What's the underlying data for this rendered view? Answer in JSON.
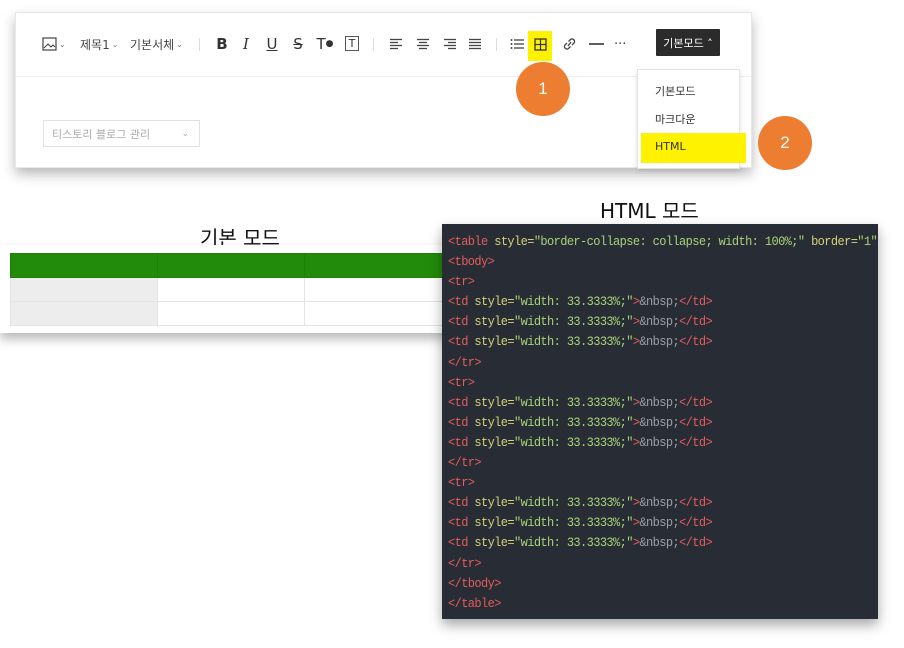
{
  "toolbar": {
    "image_caret": "⌄",
    "heading": "제목1",
    "font": "기본서체",
    "bold": "B",
    "italic": "I",
    "underline": "U",
    "strike": "S",
    "text_color": "T",
    "text_bg": "T",
    "more": "···",
    "mode_button": "기본모드 ˄"
  },
  "dropdown": {
    "items": [
      "기본모드",
      "마크다운",
      "HTML"
    ]
  },
  "blog_select": {
    "value": "티스토리 블로그 관리",
    "chevron": "⌄"
  },
  "badges": [
    "1",
    "2"
  ],
  "labels": {
    "basic_mode": "기본 모드",
    "html_mode": "HTML 모드"
  },
  "colors": {
    "highlight": "#fff200",
    "badge": "#ed7d31",
    "table_header": "#228b0c",
    "code_bg": "#282c34"
  },
  "basic_table": {
    "columns": 3,
    "rows": [
      "header",
      "gray-first",
      "gray-first"
    ]
  },
  "code": {
    "lines": [
      [
        [
          "tag",
          "<table "
        ],
        [
          "attr",
          "style="
        ],
        [
          "str",
          "\"border-collapse: collapse; width: 100%;\""
        ],
        [
          "attr",
          " border="
        ],
        [
          "str",
          "\"1\""
        ],
        [
          "tag",
          ">"
        ]
      ],
      [
        [
          "tag",
          "<tbody>"
        ]
      ],
      [
        [
          "tag",
          "<tr>"
        ]
      ],
      [
        [
          "tag",
          "<td "
        ],
        [
          "attr",
          "style="
        ],
        [
          "str",
          "\"width: 33.3333%;\""
        ],
        [
          "tag",
          ">"
        ],
        [
          "ent",
          "&nbsp;"
        ],
        [
          "tag",
          "</td>"
        ]
      ],
      [
        [
          "tag",
          "<td "
        ],
        [
          "attr",
          "style="
        ],
        [
          "str",
          "\"width: 33.3333%;\""
        ],
        [
          "tag",
          ">"
        ],
        [
          "ent",
          "&nbsp;"
        ],
        [
          "tag",
          "</td>"
        ]
      ],
      [
        [
          "tag",
          "<td "
        ],
        [
          "attr",
          "style="
        ],
        [
          "str",
          "\"width: 33.3333%;\""
        ],
        [
          "tag",
          ">"
        ],
        [
          "ent",
          "&nbsp;"
        ],
        [
          "tag",
          "</td>"
        ]
      ],
      [
        [
          "tag",
          "</tr>"
        ]
      ],
      [
        [
          "tag",
          "<tr>"
        ]
      ],
      [
        [
          "tag",
          "<td "
        ],
        [
          "attr",
          "style="
        ],
        [
          "str",
          "\"width: 33.3333%;\""
        ],
        [
          "tag",
          ">"
        ],
        [
          "ent",
          "&nbsp;"
        ],
        [
          "tag",
          "</td>"
        ]
      ],
      [
        [
          "tag",
          "<td "
        ],
        [
          "attr",
          "style="
        ],
        [
          "str",
          "\"width: 33.3333%;\""
        ],
        [
          "tag",
          ">"
        ],
        [
          "ent",
          "&nbsp;"
        ],
        [
          "tag",
          "</td>"
        ]
      ],
      [
        [
          "tag",
          "<td "
        ],
        [
          "attr",
          "style="
        ],
        [
          "str",
          "\"width: 33.3333%;\""
        ],
        [
          "tag",
          ">"
        ],
        [
          "ent",
          "&nbsp;"
        ],
        [
          "tag",
          "</td>"
        ]
      ],
      [
        [
          "tag",
          "</tr>"
        ]
      ],
      [
        [
          "tag",
          "<tr>"
        ]
      ],
      [
        [
          "tag",
          "<td "
        ],
        [
          "attr",
          "style="
        ],
        [
          "str",
          "\"width: 33.3333%;\""
        ],
        [
          "tag",
          ">"
        ],
        [
          "ent",
          "&nbsp;"
        ],
        [
          "tag",
          "</td>"
        ]
      ],
      [
        [
          "tag",
          "<td "
        ],
        [
          "attr",
          "style="
        ],
        [
          "str",
          "\"width: 33.3333%;\""
        ],
        [
          "tag",
          ">"
        ],
        [
          "ent",
          "&nbsp;"
        ],
        [
          "tag",
          "</td>"
        ]
      ],
      [
        [
          "tag",
          "<td "
        ],
        [
          "attr",
          "style="
        ],
        [
          "str",
          "\"width: 33.3333%;\""
        ],
        [
          "tag",
          ">"
        ],
        [
          "ent",
          "&nbsp;"
        ],
        [
          "tag",
          "</td>"
        ]
      ],
      [
        [
          "tag",
          "</tr>"
        ]
      ],
      [
        [
          "tag",
          "</tbody>"
        ]
      ],
      [
        [
          "tag",
          "</table>"
        ]
      ]
    ]
  }
}
